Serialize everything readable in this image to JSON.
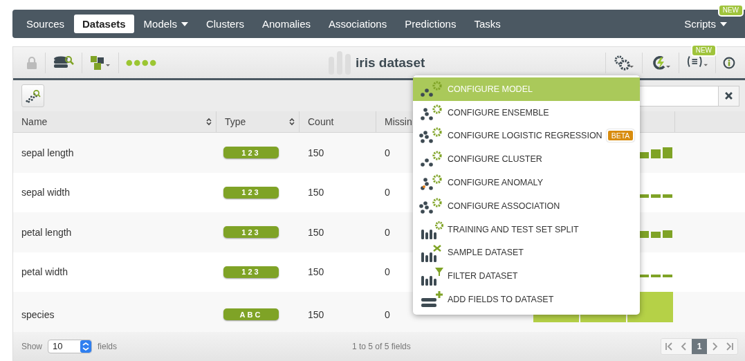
{
  "nav": {
    "items": [
      {
        "label": "Sources",
        "selected": false,
        "has_menu": false
      },
      {
        "label": "Datasets",
        "selected": true,
        "has_menu": false
      },
      {
        "label": "Models",
        "selected": false,
        "has_menu": true
      },
      {
        "label": "Clusters",
        "selected": false,
        "has_menu": false
      },
      {
        "label": "Anomalies",
        "selected": false,
        "has_menu": false
      },
      {
        "label": "Associations",
        "selected": false,
        "has_menu": false
      },
      {
        "label": "Predictions",
        "selected": false,
        "has_menu": false
      },
      {
        "label": "Tasks",
        "selected": false,
        "has_menu": false
      }
    ],
    "right": {
      "label": "Scripts",
      "badge": "NEW",
      "has_menu": true
    }
  },
  "toolbar": {
    "title": "iris dataset",
    "script_badge": "NEW"
  },
  "table": {
    "columns": [
      "Name",
      "Type",
      "Count",
      "Missin"
    ],
    "rows": [
      {
        "name": "sepal length",
        "type": "123",
        "count": "150",
        "missing": "0"
      },
      {
        "name": "sepal width",
        "type": "123",
        "count": "150",
        "missing": "0"
      },
      {
        "name": "petal length",
        "type": "123",
        "count": "150",
        "missing": "0"
      },
      {
        "name": "petal width",
        "type": "123",
        "count": "150",
        "missing": "0"
      },
      {
        "name": "species",
        "type": "ABC",
        "count": "150",
        "missing": "0"
      }
    ]
  },
  "menu": {
    "items": [
      {
        "label": "CONFIGURE MODEL",
        "selected": true
      },
      {
        "label": "CONFIGURE ENSEMBLE",
        "selected": false
      },
      {
        "label": "CONFIGURE LOGISTIC REGRESSION",
        "selected": false,
        "badge": "BETA"
      },
      {
        "label": "CONFIGURE CLUSTER",
        "selected": false
      },
      {
        "label": "CONFIGURE ANOMALY",
        "selected": false
      },
      {
        "label": "CONFIGURE ASSOCIATION",
        "selected": false
      },
      {
        "label": "TRAINING AND TEST SET SPLIT",
        "selected": false
      },
      {
        "label": "SAMPLE DATASET",
        "selected": false
      },
      {
        "label": "FILTER DATASET",
        "selected": false
      },
      {
        "label": "ADD FIELDS TO DATASET",
        "selected": false
      }
    ]
  },
  "footer": {
    "show_label": "Show",
    "page_size": "10",
    "fields_label": "fields",
    "summary": "1 to 5 of 5 fields",
    "pages": [
      {
        "label": "1",
        "selected": true
      }
    ]
  }
}
